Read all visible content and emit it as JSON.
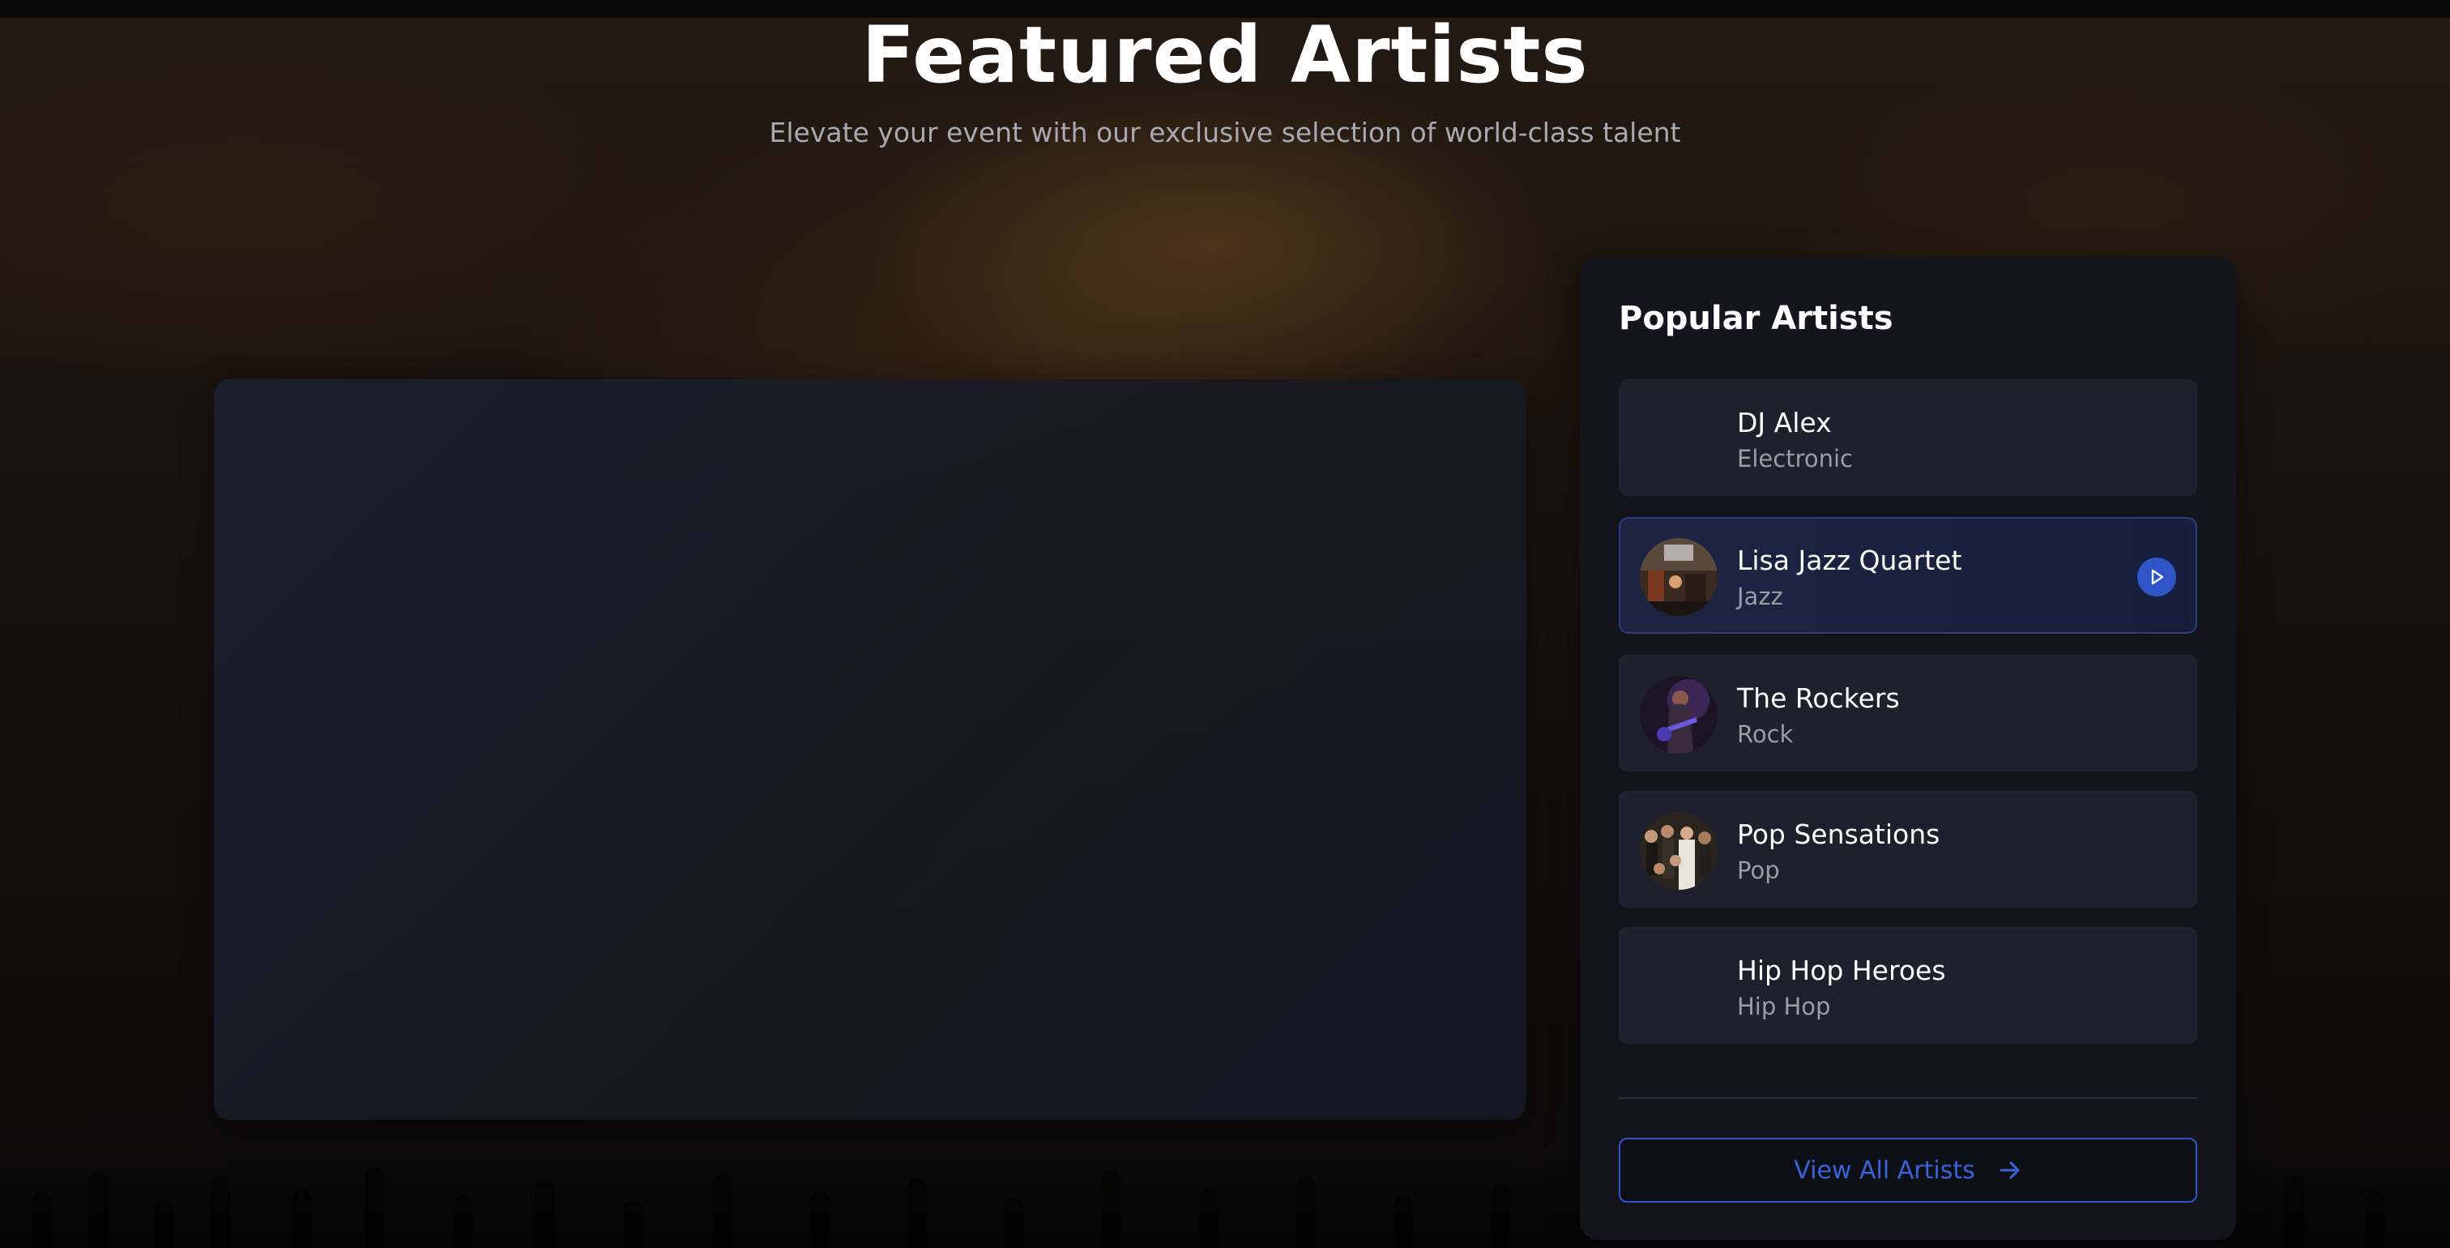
{
  "header": {
    "title": "Featured Artists",
    "subtitle": "Elevate your event with our exclusive selection of world-class talent"
  },
  "sidebar": {
    "title": "Popular Artists",
    "artists": [
      {
        "name": "DJ Alex",
        "genre": "Electronic",
        "avatar": "none",
        "active": false
      },
      {
        "name": "Lisa Jazz Quartet",
        "genre": "Jazz",
        "avatar": "jazz-club-photo",
        "active": true
      },
      {
        "name": "The Rockers",
        "genre": "Rock",
        "avatar": "guitarist-photo",
        "active": false
      },
      {
        "name": "Pop Sensations",
        "genre": "Pop",
        "avatar": "crowd-photo",
        "active": false
      },
      {
        "name": "Hip Hop Heroes",
        "genre": "Hip Hop",
        "avatar": "none",
        "active": false
      }
    ],
    "view_all_label": "View All Artists"
  },
  "colors": {
    "accent": "#2f55c9",
    "card": "#1e212b",
    "active_card": "#1c2442",
    "muted_text": "#9a9ca6"
  },
  "icons": {
    "play": "play-icon",
    "arrow": "arrow-right-icon"
  }
}
